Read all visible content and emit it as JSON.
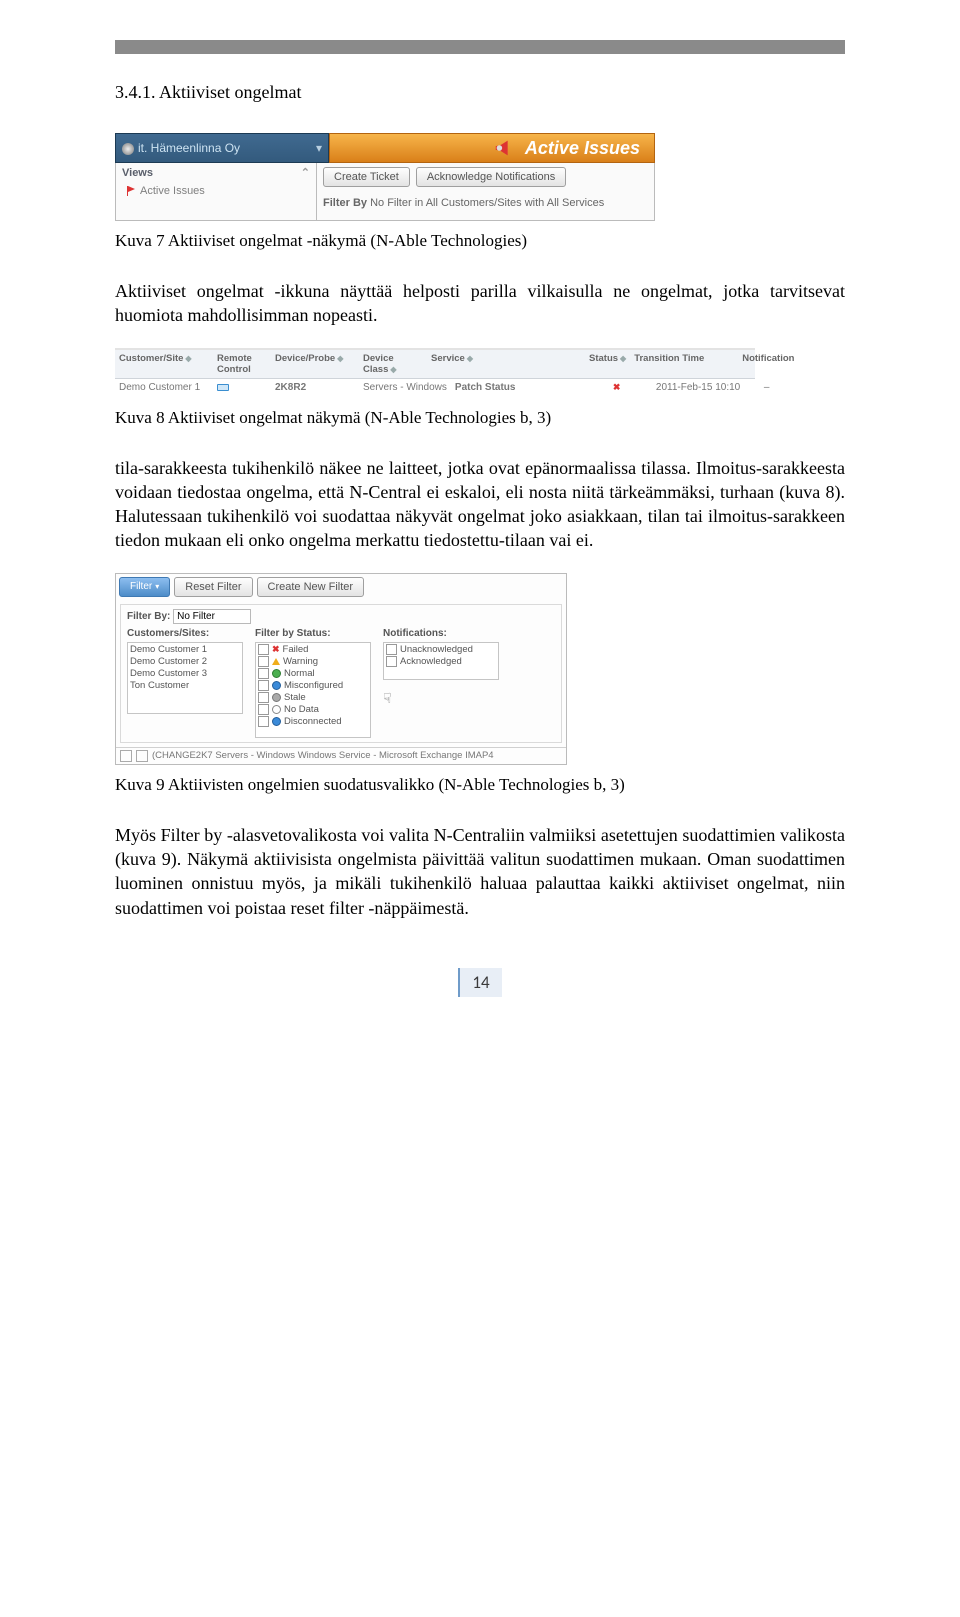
{
  "heading": "3.4.1.  Aktiiviset ongelmat",
  "paragraph1": "Aktiiviset ongelmat -ikkuna näyttää helposti parilla vilkaisulla ne ongelmat, jotka tarvitsevat huomiota mahdollisimman nopeasti.",
  "paragraph2": "tila-sarakkeesta tukihenkilö näkee ne laitteet, jotka ovat epänormaalissa tilassa. Ilmoitus-sarakkeesta voidaan tiedostaa ongelma, että N-Central ei eskaloi, eli nosta niitä tärkeämmäksi, turhaan (kuva 8). Halutessaan tukihenkilö voi suodattaa näkyvät ongelmat joko asiakkaan, tilan tai ilmoitus-sarakkeen tiedon mukaan eli onko ongelma merkattu tiedostettu-tilaan vai ei.",
  "paragraph3": "Myös Filter by -alasvetovalikosta voi valita N-Centraliin valmiiksi asetettujen suodattimien valikosta (kuva 9). Näkymä aktiivisista ongelmista päivittää valitun suodattimen mukaan. Oman suodattimen luominen onnistuu myös, ja mikäli tukihenkilö haluaa palauttaa kaikki aktiiviset ongelmat, niin suodattimen voi poistaa reset filter -näppäimestä.",
  "caption7": "Kuva 7 Aktiiviset ongelmat -näkymä (N-Able Technologies)",
  "caption8": "Kuva 8 Aktiiviset ongelmat näkymä (N-Able Technologies b, 3)",
  "caption9": "Kuva 9 Aktiivisten ongelmien suodatusvalikko (N-Able Technologies b, 3)",
  "pageNumber": "14",
  "fig7": {
    "org": "it. Hämeenlinna Oy",
    "banner": "Active Issues",
    "viewsLabel": "Views",
    "activeIssues": "Active Issues",
    "btnCreate": "Create Ticket",
    "btnAck": "Acknowledge Notifications",
    "filterBy": "Filter By",
    "filterLine": "No Filter in All Customers/Sites with All Services"
  },
  "fig8": {
    "headers": {
      "customerSite": "Customer/Site",
      "remoteControl": "Remote Control",
      "deviceProbe": "Device/Probe",
      "deviceClass": "Device Class",
      "service": "Service",
      "status": "Status",
      "transitionTime": "Transition Time",
      "notification": "Notification"
    },
    "row": {
      "customerSite": "Demo Customer 1",
      "deviceProbe": "2K8R2",
      "deviceClass": "Servers - Windows",
      "service": "Patch Status",
      "transitionTime": "2011-Feb-15 10:10",
      "notification": "–"
    }
  },
  "fig9": {
    "filter": "Filter",
    "reset": "Reset Filter",
    "createNew": "Create New Filter",
    "filterByLabel": "Filter By:",
    "filterByValue": "No Filter",
    "customersLabel": "Customers/Sites:",
    "statusLabel": "Filter by Status:",
    "notificationsLabel": "Notifications:",
    "customers": [
      "Demo Customer 1",
      "Demo Customer 2",
      "Demo Customer 3",
      "Ton Customer"
    ],
    "statuses": [
      "Failed",
      "Warning",
      "Normal",
      "Misconfigured",
      "Stale",
      "No Data",
      "Disconnected"
    ],
    "notifications": [
      "Unacknowledged",
      "Acknowledged"
    ],
    "bottomRow": "(CHANGE2K7    Servers - Windows   Windows Service - Microsoft Exchange IMAP4"
  }
}
